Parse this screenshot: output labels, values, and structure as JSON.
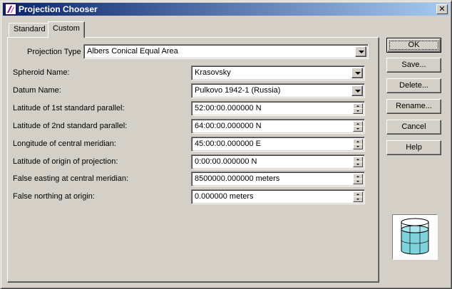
{
  "window": {
    "title": "Projection Chooser",
    "close_glyph": "✕"
  },
  "tabs": [
    {
      "label": "Standard",
      "active": false
    },
    {
      "label": "Custom",
      "active": true
    }
  ],
  "projection_type": {
    "label": "Projection Type :",
    "value": "Albers Conical Equal Area"
  },
  "fields": [
    {
      "label": "Spheroid Name:",
      "value": "Krasovsky",
      "control": "dropdown"
    },
    {
      "label": "Datum Name:",
      "value": "Pulkovo 1942-1 (Russia)",
      "control": "dropdown"
    },
    {
      "label": "Latitude of 1st standard parallel:",
      "value": "52:00:00.000000 N",
      "control": "spinner"
    },
    {
      "label": "Latitude of 2nd standard parallel:",
      "value": "64:00:00.000000 N",
      "control": "spinner"
    },
    {
      "label": "Longitude of central meridian:",
      "value": "45:00:00.000000 E",
      "control": "spinner"
    },
    {
      "label": "Latitude of origin of projection:",
      "value": "0:00:00.000000 N",
      "control": "spinner"
    },
    {
      "label": "False easting at central meridian:",
      "value": "8500000.000000 meters",
      "control": "spinner"
    },
    {
      "label": "False northing at origin:",
      "value": "0.000000 meters",
      "control": "spinner"
    }
  ],
  "buttons": {
    "ok": "OK",
    "save": "Save...",
    "delete": "Delete...",
    "rename": "Rename...",
    "cancel": "Cancel",
    "help": "Help"
  },
  "preview": {
    "icon": "conic-projection-preview-icon"
  },
  "colors": {
    "titlebar_start": "#0a246a",
    "titlebar_end": "#a6caf0",
    "dialog_bg": "#d4d0c8",
    "preview_fill": "#7fd4dc"
  }
}
